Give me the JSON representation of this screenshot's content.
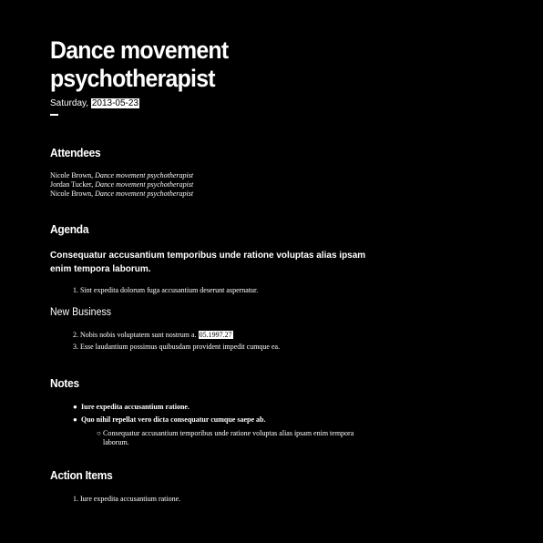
{
  "document": {
    "title": "Dance movement psychotherapist",
    "date_prefix": "Saturday,",
    "date": "2013-05-23"
  },
  "attendees": {
    "heading": "Attendees",
    "items": [
      {
        "name": "Nicole Brown,",
        "role": "Dance movement psychotherapist"
      },
      {
        "name": "Jordan Tucker,",
        "role": "Dance movement psychotherapist"
      },
      {
        "name": "Nicole Brown,",
        "role": "Dance movement psychotherapist"
      }
    ]
  },
  "agenda": {
    "heading": "Agenda",
    "intro": "Consequatur accusantium temporibus unde ratione voluptas alias ipsam enim tempora laborum.",
    "items": [
      {
        "number": "1.",
        "text": "Sint expedita dolorum fuga accusantium deserunt aspernatur."
      }
    ]
  },
  "new_business": {
    "heading": "New Business",
    "items": [
      {
        "number": "2.",
        "text": "Nobis nobis voluptatem sunt nostrum a.",
        "highlight": "05.1997.27"
      },
      {
        "number": "3.",
        "text": "Esse laudantium possimus quibusdam provident impedit cumque ea."
      }
    ]
  },
  "notes": {
    "heading": "Notes",
    "items": [
      {
        "bullet": "●",
        "text": "Iure expedita accusantium ratione."
      },
      {
        "bullet": "●",
        "text": "Quo nihil repellat vero dicta consequatur cumque saepe ab."
      }
    ],
    "sub_items": [
      {
        "bullet": "○",
        "text": "Consequatur accusantium temporibus unde ratione voluptas alias ipsam enim tempora laborum."
      }
    ]
  },
  "action_items": {
    "heading": "Action Items",
    "items": [
      {
        "number": "1.",
        "text": "Iure expedita accusantium ratione."
      }
    ]
  }
}
